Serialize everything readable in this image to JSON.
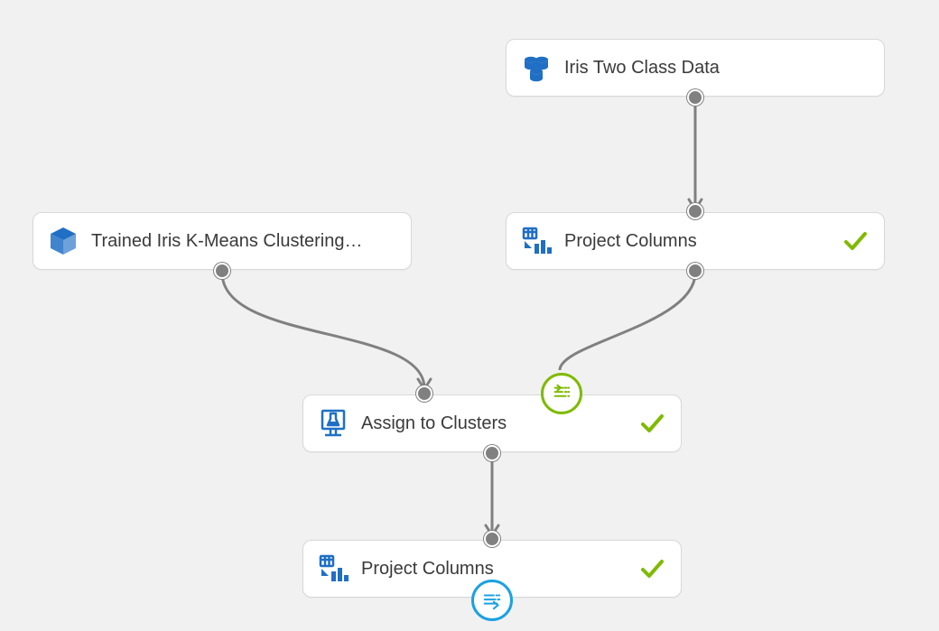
{
  "nodes": {
    "iris_data": {
      "label": "Iris Two Class Data"
    },
    "trained_model": {
      "label": "Trained Iris K-Means Clustering…"
    },
    "project_cols_1": {
      "label": "Project Columns"
    },
    "assign_clusters": {
      "label": "Assign to Clusters"
    },
    "project_cols_2": {
      "label": "Project Columns"
    }
  },
  "status": {
    "completed": "completed"
  }
}
